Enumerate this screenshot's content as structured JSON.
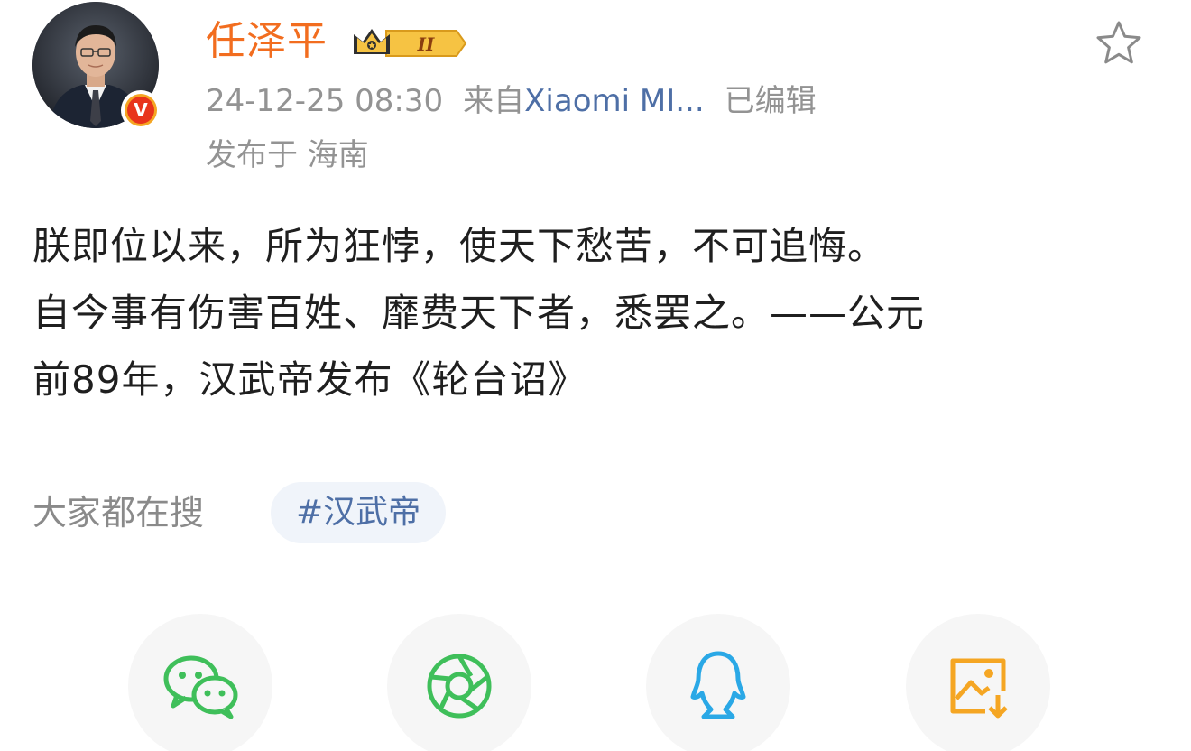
{
  "post": {
    "author": "任泽平",
    "vip_level": "II",
    "timestamp": "24-12-25 08:30",
    "source_prefix": "来自",
    "source_device": "Xiaomi MI...",
    "edited": "已编辑",
    "location": "发布于 海南",
    "text_lines": [
      "朕即位以来，所为狂悖，使天下愁苦，不可追悔。",
      "自今事有伤害百姓、靡费天下者，悉罢之。——公元",
      "前89年，汉武帝发布《轮台诏》"
    ]
  },
  "trending": {
    "label": "大家都在搜",
    "topic": "#汉武帝"
  },
  "share": {
    "items": [
      {
        "icon": "wechat-icon",
        "color": "#3fbf5a"
      },
      {
        "icon": "moments-icon",
        "color": "#3fbf5a"
      },
      {
        "icon": "qq-icon",
        "color": "#2aa8e6"
      },
      {
        "icon": "save-image-icon",
        "color": "#f5a623"
      }
    ]
  },
  "colors": {
    "username": "#f26d1f",
    "meta_text": "#939393",
    "link": "#4e6fa6",
    "body_text": "#1f1f1f",
    "chip_bg": "#f0f4fa",
    "share_bg": "#f6f6f6",
    "verified_red": "#e8341c",
    "verified_gold": "#f5a623"
  }
}
